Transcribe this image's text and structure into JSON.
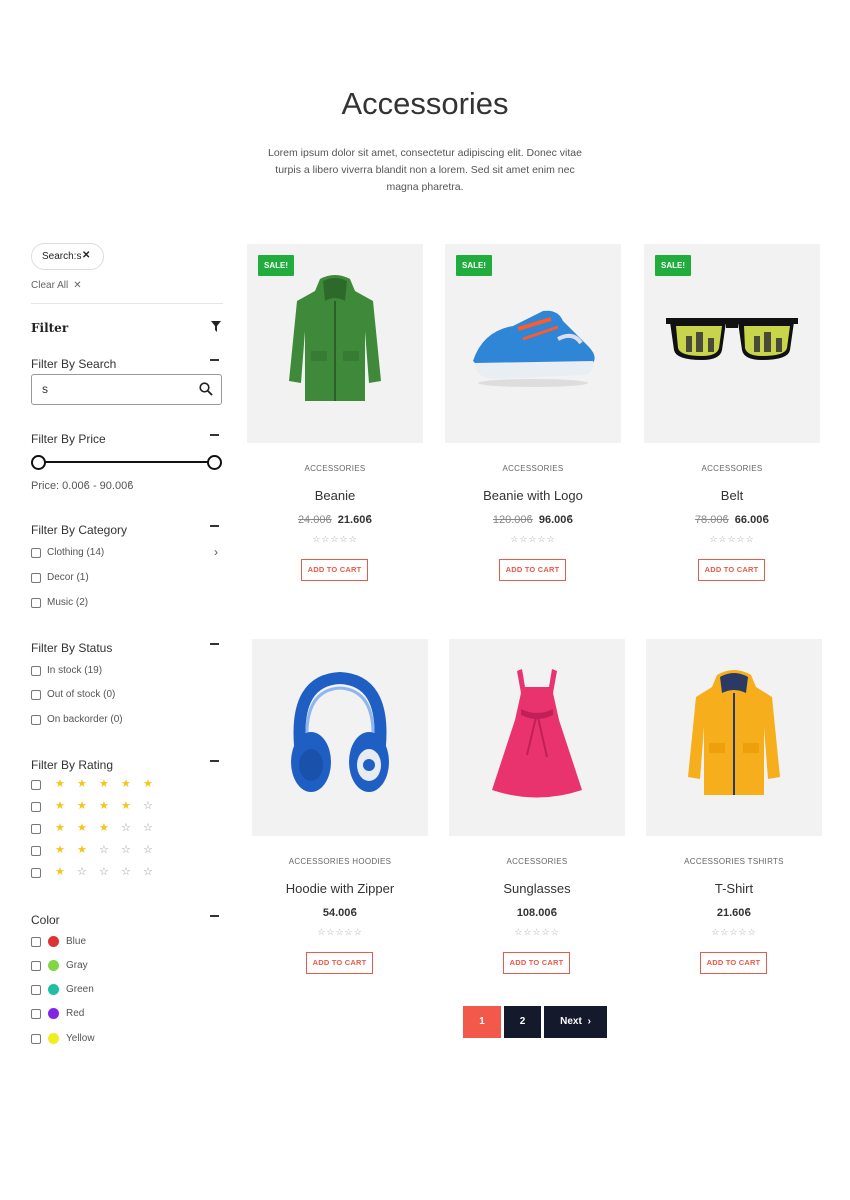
{
  "page": {
    "title": "Accessories",
    "description": "Lorem ipsum dolor sit amet, consectetur adipiscing elit. Donec vitae turpis a libero viverra blandit non a lorem. Sed sit amet enim nec magna pharetra."
  },
  "sidebar": {
    "active_chip": "Search:s",
    "clear_all": "Clear All",
    "filter_label": "Filter",
    "search": {
      "title": "Filter By Search",
      "value": "s"
    },
    "price": {
      "title": "Filter By Price",
      "text": "Price: 0.00ϐ  - 90.00ϐ"
    },
    "category": {
      "title": "Filter By Category",
      "items": [
        "Clothing (14)",
        "Decor (1)",
        "Music (2)"
      ]
    },
    "status": {
      "title": "Filter By Status",
      "items": [
        "In stock (19)",
        "Out of stock (0)",
        "On backorder (0)"
      ]
    },
    "rating": {
      "title": "Filter By Rating",
      "levels": [
        5,
        4,
        3,
        2,
        1
      ],
      "max": 5
    },
    "color": {
      "title": "Color",
      "items": [
        {
          "label": "Blue",
          "swatch": "#dd3333"
        },
        {
          "label": "Gray",
          "swatch": "#81d742"
        },
        {
          "label": "Green",
          "swatch": "#1ebfa5"
        },
        {
          "label": "Red",
          "swatch": "#8224e3"
        },
        {
          "label": "Yellow",
          "swatch": "#eeee22"
        }
      ]
    }
  },
  "products": [
    {
      "name": "Beanie",
      "category": "ACCESSORIES",
      "old_price": "24.00ϐ",
      "price": "21.60ϐ",
      "sale_badge": "SALE!",
      "image": "green-jacket",
      "add_to_cart": "ADD TO CART"
    },
    {
      "name": "Beanie with Logo",
      "category": "ACCESSORIES",
      "old_price": "120.00ϐ",
      "price": "96.00ϐ",
      "sale_badge": "SALE!",
      "image": "blue-sneaker",
      "add_to_cart": "ADD TO CART"
    },
    {
      "name": "Belt",
      "category": "ACCESSORIES",
      "old_price": "78.00ϐ",
      "price": "66.00ϐ",
      "sale_badge": "SALE!",
      "image": "sunglasses",
      "add_to_cart": "ADD TO CART"
    },
    {
      "name": "Hoodie with Zipper",
      "category": "ACCESSORIES  HOODIES",
      "price": "54.00ϐ",
      "image": "blue-headphones",
      "add_to_cart": "ADD TO CART"
    },
    {
      "name": "Sunglasses",
      "category": "ACCESSORIES",
      "price": "108.00ϐ",
      "image": "pink-dress",
      "add_to_cart": "ADD TO CART"
    },
    {
      "name": "T-Shirt",
      "category": "ACCESSORIES  TSHIRTS",
      "price": "21.60ϐ",
      "image": "yellow-jacket",
      "add_to_cart": "ADD TO CART"
    }
  ],
  "rating_placeholder": "☆☆☆☆☆",
  "pagination": {
    "pages": [
      "1",
      "2"
    ],
    "current": "1",
    "next_label": "Next"
  },
  "colors": {
    "accent": "#f2594b",
    "dark": "#141a2b",
    "sale": "#21ad3e",
    "star": "#f5c518"
  }
}
